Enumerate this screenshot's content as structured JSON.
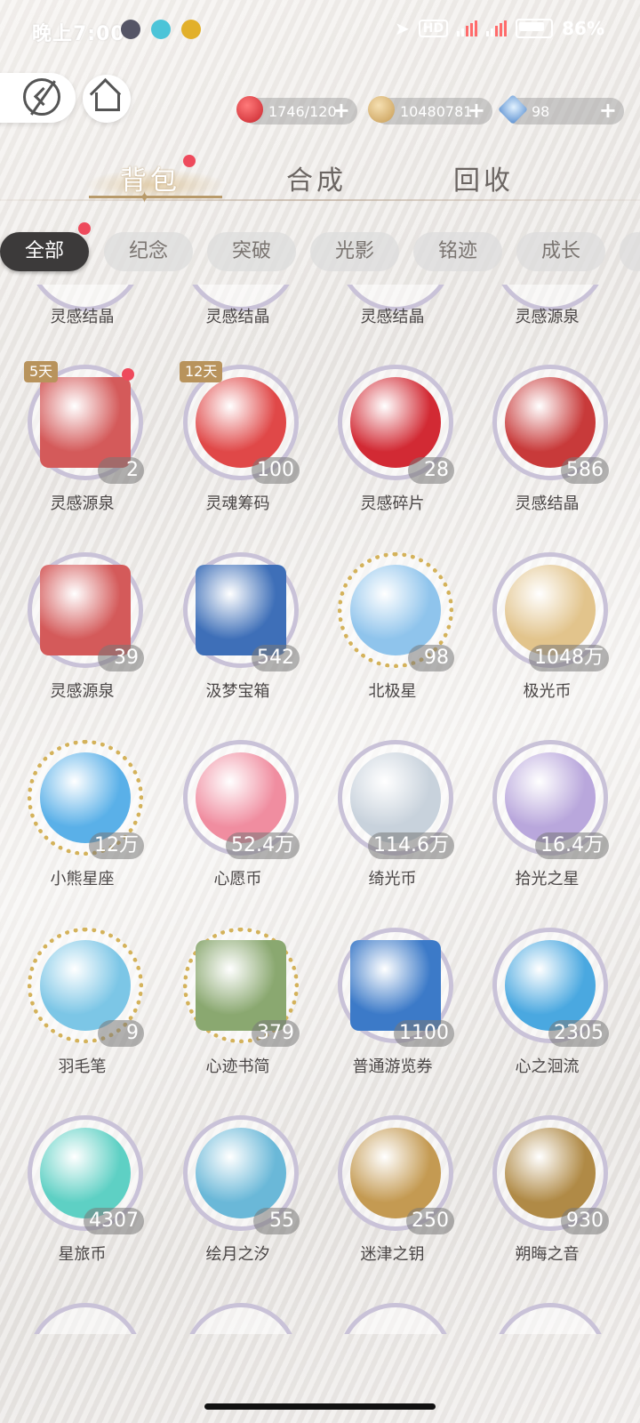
{
  "status": {
    "time": "晚上7:00",
    "battery": "86%"
  },
  "currency": [
    {
      "name": "apple-currency-icon",
      "value": "1746/120",
      "color": "#d9343a"
    },
    {
      "name": "coin-currency-icon",
      "value": "10480781",
      "color": "#d8b77a"
    },
    {
      "name": "crystal-currency-icon",
      "value": "98",
      "color": "#6fa6e0"
    }
  ],
  "tabs": [
    "背包",
    "合成",
    "回收"
  ],
  "chips": [
    "全部",
    "纪念",
    "突破",
    "光影",
    "铭迹",
    "成长"
  ],
  "partial_top": [
    "灵感结晶",
    "灵感结晶",
    "灵感结晶",
    "灵感源泉"
  ],
  "items": [
    {
      "name": "灵感源泉",
      "count": "2",
      "tag": "5天",
      "icon": "apple-box-icon",
      "color": "#d45a5a",
      "ring": "plain",
      "dot": true
    },
    {
      "name": "灵魂筹码",
      "count": "100",
      "tag": "12天",
      "icon": "chip-token-icon",
      "color": "#e04848",
      "ring": "plain",
      "dot": false
    },
    {
      "name": "灵感碎片",
      "count": "28",
      "tag": "",
      "icon": "apples-icon",
      "color": "#d22a34",
      "ring": "plain",
      "dot": false
    },
    {
      "name": "灵感结晶",
      "count": "586",
      "tag": "",
      "icon": "apple-basket-icon",
      "color": "#c83a3a",
      "ring": "plain",
      "dot": false
    },
    {
      "name": "灵感源泉",
      "count": "39",
      "tag": "",
      "icon": "apple-box-icon",
      "color": "#d45a5a",
      "ring": "plain",
      "dot": false
    },
    {
      "name": "汲梦宝箱",
      "count": "542",
      "tag": "",
      "icon": "blue-chest-icon",
      "color": "#3e6fb8",
      "ring": "plain",
      "dot": false
    },
    {
      "name": "北极星",
      "count": "98",
      "tag": "",
      "icon": "crystal-icon",
      "color": "#8fc4ec",
      "ring": "gold",
      "dot": false
    },
    {
      "name": "极光币",
      "count": "1048万",
      "tag": "",
      "icon": "gold-coin-icon",
      "color": "#e2c48c",
      "ring": "plain",
      "dot": false
    },
    {
      "name": "小熊星座",
      "count": "12万",
      "tag": "",
      "icon": "blue-coin-icon",
      "color": "#5ab0e8",
      "ring": "gold",
      "dot": false
    },
    {
      "name": "心愿币",
      "count": "52.4万",
      "tag": "",
      "icon": "pink-coin-icon",
      "color": "#f08da0",
      "ring": "plain",
      "dot": false
    },
    {
      "name": "绮光币",
      "count": "114.6万",
      "tag": "",
      "icon": "silver-coin-icon",
      "color": "#c8d2dc",
      "ring": "plain",
      "dot": false
    },
    {
      "name": "拾光之星",
      "count": "16.4万",
      "tag": "",
      "icon": "sparkle-star-icon",
      "color": "#b9a7dc",
      "ring": "plain",
      "dot": false
    },
    {
      "name": "羽毛笔",
      "count": "9",
      "tag": "",
      "icon": "quill-icon",
      "color": "#7cc6e6",
      "ring": "gold",
      "dot": false
    },
    {
      "name": "心迹书简",
      "count": "379",
      "tag": "",
      "icon": "letter-icon",
      "color": "#8aa870",
      "ring": "gold",
      "dot": false
    },
    {
      "name": "普通游览券",
      "count": "1100",
      "tag": "",
      "icon": "ticket-icon",
      "color": "#3c7ac8",
      "ring": "plain",
      "dot": false
    },
    {
      "name": "心之洄流",
      "count": "2305",
      "tag": "",
      "icon": "water-drop-icon",
      "color": "#4aa8e0",
      "ring": "plain",
      "dot": false
    },
    {
      "name": "星旅币",
      "count": "4307",
      "tag": "",
      "icon": "teal-coin-icon",
      "color": "#5ed0c4",
      "ring": "plain",
      "dot": false
    },
    {
      "name": "绘月之汐",
      "count": "55",
      "tag": "",
      "icon": "moon-bottle-icon",
      "color": "#6ab8d8",
      "ring": "plain",
      "dot": false
    },
    {
      "name": "迷津之钥",
      "count": "250",
      "tag": "",
      "icon": "golden-key-icon",
      "color": "#c49a52",
      "ring": "plain",
      "dot": false
    },
    {
      "name": "朔晦之音",
      "count": "930",
      "tag": "",
      "icon": "astrolabe-icon",
      "color": "#b08a46",
      "ring": "plain",
      "dot": false
    }
  ]
}
